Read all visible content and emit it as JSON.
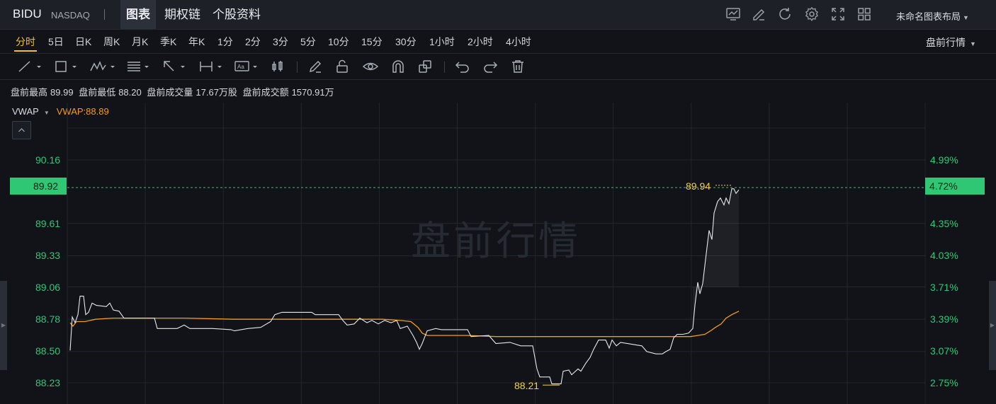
{
  "header": {
    "ticker": "BIDU",
    "exchange": "NASDAQ",
    "tabs": [
      {
        "label": "图表",
        "active": true
      },
      {
        "label": "期权链",
        "active": false
      },
      {
        "label": "个股资料",
        "active": false
      }
    ],
    "layout_name": "未命名图表布局",
    "icons": [
      "chart-indicator-icon",
      "draw-icon",
      "refresh-icon",
      "gear-icon",
      "fullscreen-icon",
      "layout-grid-icon"
    ]
  },
  "periods": {
    "items": [
      "分时",
      "5日",
      "日K",
      "周K",
      "月K",
      "季K",
      "年K",
      "1分",
      "2分",
      "3分",
      "5分",
      "10分",
      "15分",
      "30分",
      "1小时",
      "2小时",
      "4小时"
    ],
    "active": "分时",
    "session_select": "盘前行情"
  },
  "stats": {
    "high_label": "盘前最高",
    "high": "89.99",
    "low_label": "盘前最低",
    "low": "88.20",
    "volume_label": "盘前成交量",
    "volume": "17.67万股",
    "turnover_label": "盘前成交额",
    "turnover": "1570.91万"
  },
  "indicator": {
    "name": "VWAP",
    "value_text": "VWAP:88.89"
  },
  "chart": {
    "watermark": "盘前行情",
    "price_ticks": [
      "90.16",
      "89.61",
      "89.33",
      "89.06",
      "88.78",
      "88.50",
      "88.23"
    ],
    "percent_ticks": [
      "4.99%",
      "4.35%",
      "4.03%",
      "3.71%",
      "3.39%",
      "3.07%",
      "2.75%"
    ],
    "current_price": "89.92",
    "current_percent": "4.72%",
    "high_marker": "89.94",
    "low_marker": "88.21",
    "colors": {
      "price_line": "#e8e8e8",
      "vwap_line": "#f39c1c",
      "axis_text": "#2fc773",
      "current_tag": "#2fc773",
      "marker": "#f5d33b"
    }
  }
}
